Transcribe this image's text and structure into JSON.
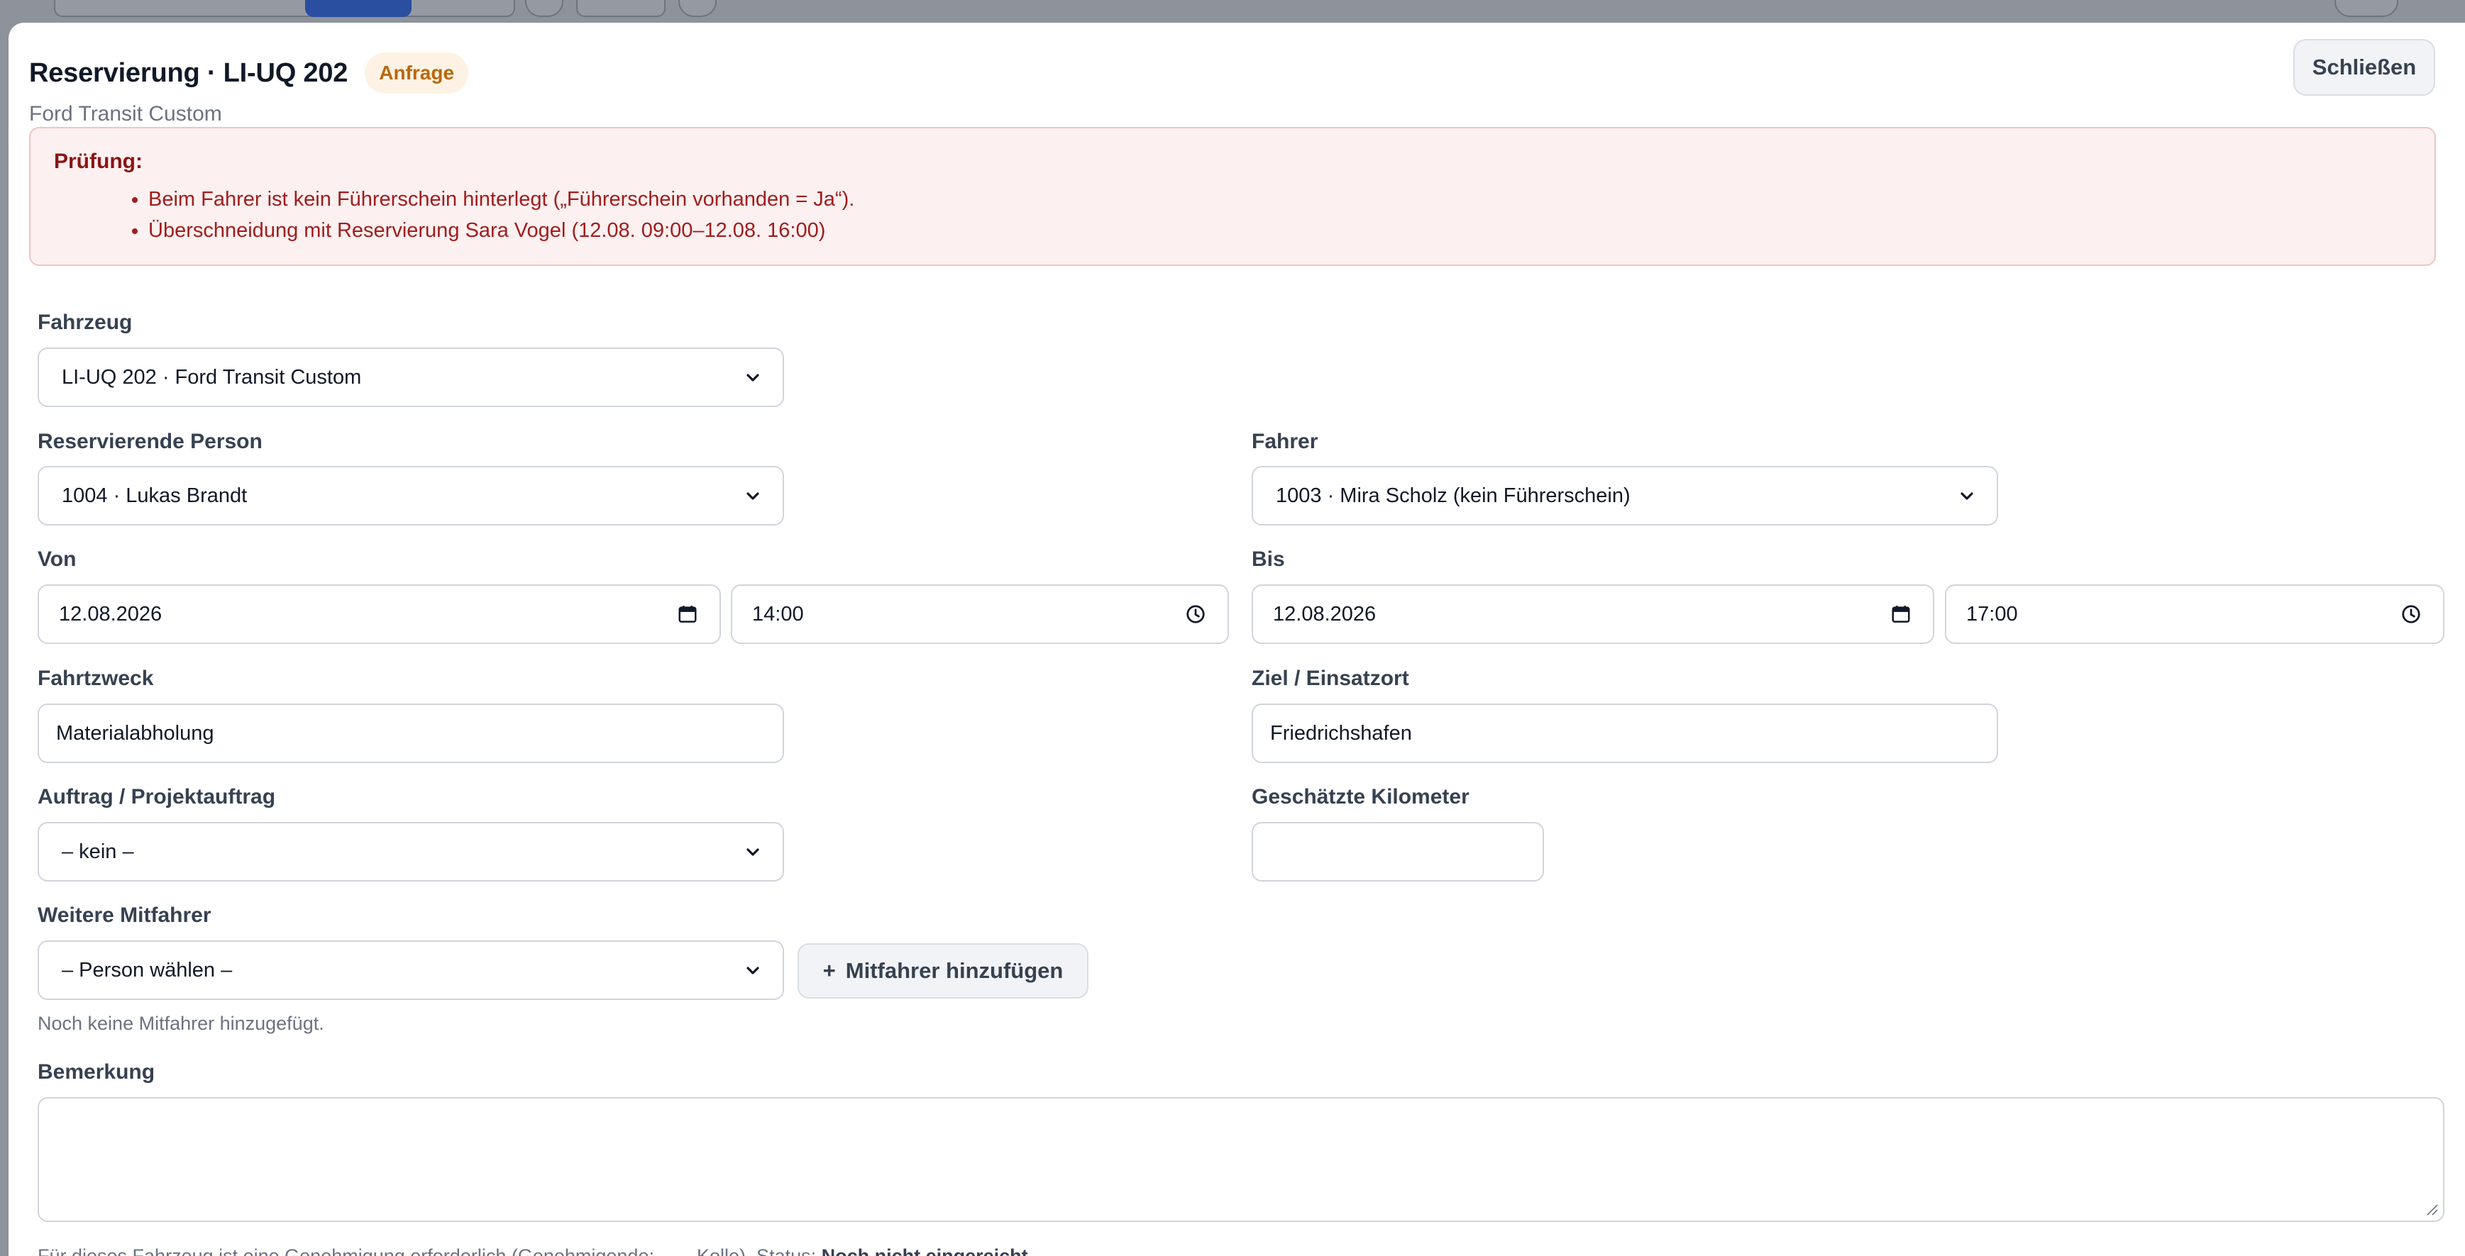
{
  "modal": {
    "title": "Reservierung · LI-UQ 202",
    "status_badge": "Anfrage",
    "subtitle": "Ford Transit Custom",
    "close_label": "Schließen"
  },
  "alert": {
    "title": "Prüfung:",
    "items": [
      "Beim Fahrer ist kein Führerschein hinterlegt („Führerschein vorhanden = Ja“).",
      "Überschneidung mit Reservierung Sara Vogel (12.08. 09:00–12.08. 16:00)"
    ]
  },
  "form": {
    "vehicle": {
      "label": "Fahrzeug",
      "value": "LI-UQ 202 · Ford Transit Custom"
    },
    "reserver": {
      "label": "Reservierende Person",
      "value": "1004 · Lukas Brandt"
    },
    "driver": {
      "label": "Fahrer",
      "value": "1003 · Mira Scholz (kein Führerschein)"
    },
    "from": {
      "label": "Von",
      "date": "12.08.2026",
      "time": "14:00"
    },
    "to": {
      "label": "Bis",
      "date": "12.08.2026",
      "time": "17:00"
    },
    "purpose": {
      "label": "Fahrtzweck",
      "value": "Materialabholung"
    },
    "destination": {
      "label": "Ziel / Einsatzort",
      "value": "Friedrichshafen"
    },
    "order": {
      "label": "Auftrag / Projektauftrag",
      "value": "– kein –"
    },
    "km": {
      "label": "Geschätzte Kilometer",
      "value": ""
    },
    "passengers": {
      "label": "Weitere Mitfahrer",
      "select_value": "– Person wählen –",
      "add_label": "Mitfahrer hinzufügen",
      "add_icon": "+",
      "empty_hint": "Noch keine Mitfahrer hinzugefügt."
    },
    "remark": {
      "label": "Bemerkung",
      "value": ""
    },
    "footer_note_prefix": "Für dieses Fahrzeug ist eine Genehmigung erforderlich (Genehmigende: ___ Kolle). Status: ",
    "footer_note_status": "Noch nicht eingereicht"
  }
}
